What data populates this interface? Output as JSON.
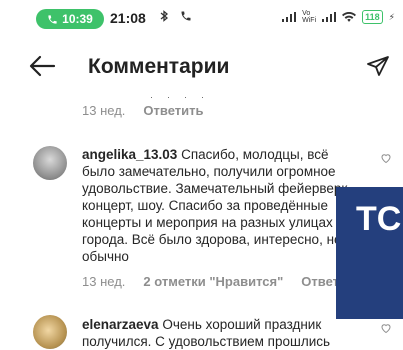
{
  "status_bar": {
    "call_time": "10:39",
    "clock": "21:08",
    "carrier_tag_a": "Vo",
    "carrier_tag_b": "WiFi",
    "battery": "118",
    "charging_mark": "⚡"
  },
  "header": {
    "title": "Комментарии"
  },
  "prev_comment": {
    "time": "13 нед.",
    "reply": "Ответить"
  },
  "comments": [
    {
      "username": "angelika_13.03",
      "text": "Спасибо, молодцы, всё было замечательно, получили огромное удовольствие. Замечательный фейерверк, концерт, шоу. Спасибо за проведённые концерты и мероприя на разных улицах города. Всё было здорова, интересно, не обычно",
      "time": "13 нед.",
      "likes": "2 отметки \"Нравится\"",
      "reply": "Ответ"
    },
    {
      "username": "elenarzaeva",
      "text": "Очень хороший праздник получился. С удовольствием прошлись"
    }
  ],
  "overlay": {
    "text": "TC",
    "color": "#243f7d"
  }
}
